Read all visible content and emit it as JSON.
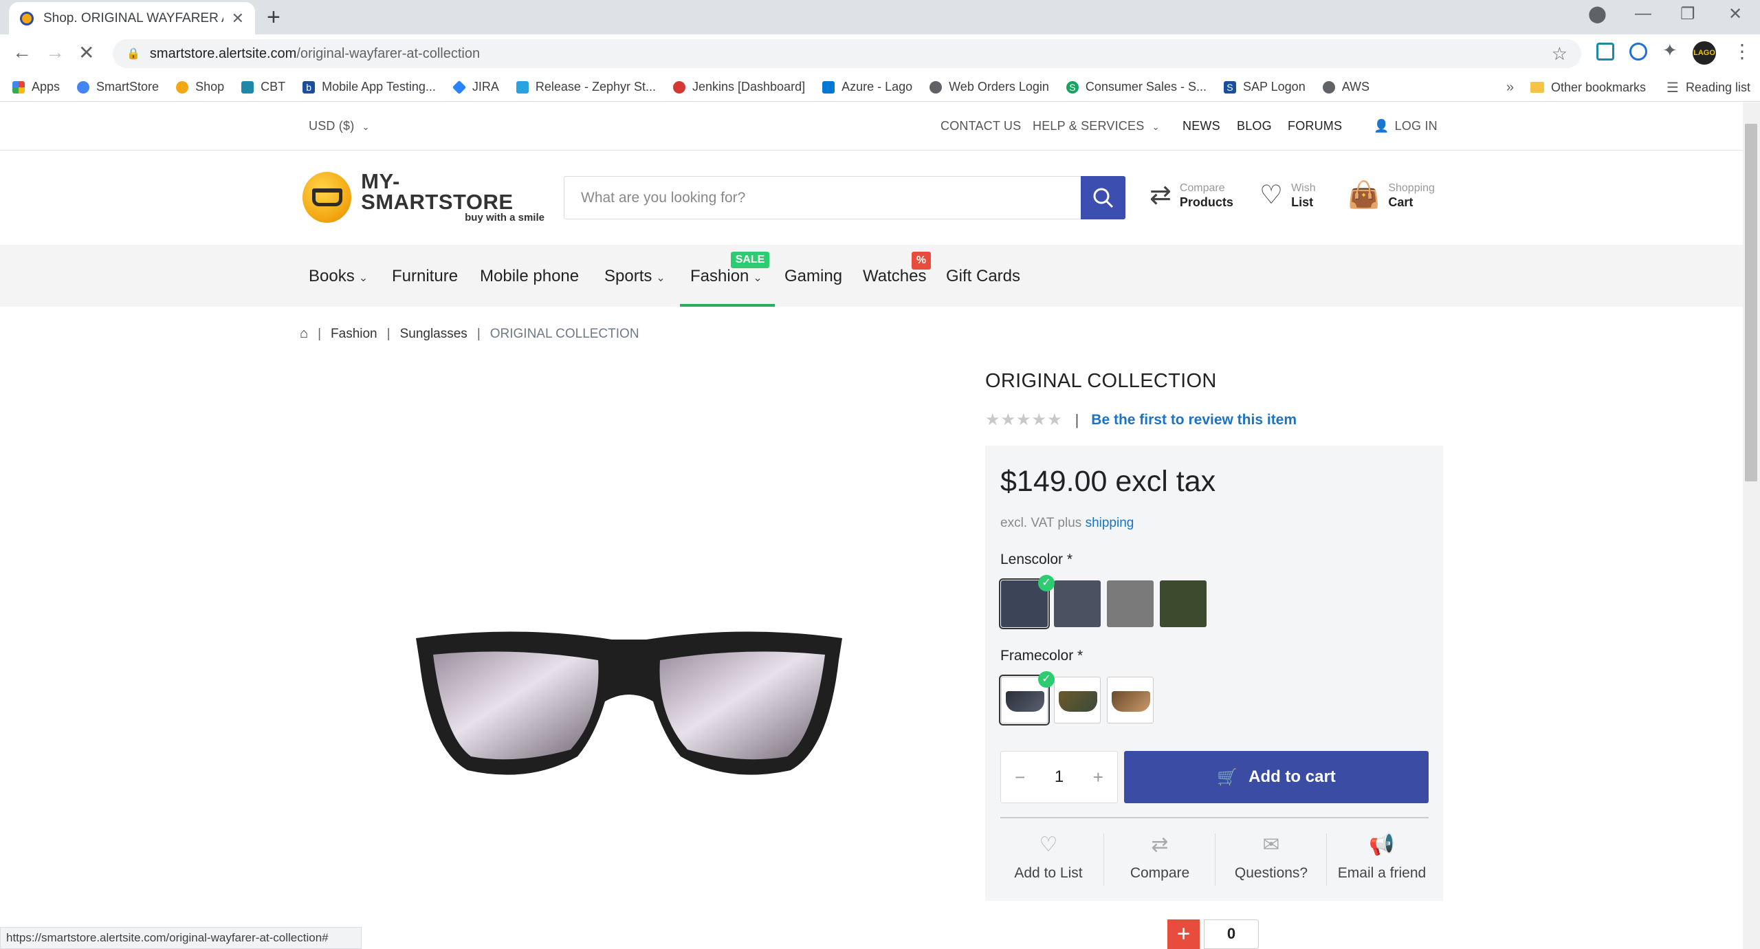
{
  "browser": {
    "tab_title": "Shop. ORIGINAL WAYFARER AT C",
    "url_domain": "smartstore.alertsite.com",
    "url_path": "/original-wayfarer-at-collection",
    "status_url": "https://smartstore.alertsite.com/original-wayfarer-at-collection#",
    "bookmarks": [
      "Apps",
      "SmartStore",
      "Shop",
      "CBT",
      "Mobile App Testing...",
      "JIRA",
      "Release - Zephyr St...",
      "Jenkins [Dashboard]",
      "Azure - Lago",
      "Web Orders Login",
      "Consumer Sales - S...",
      "SAP Logon",
      "AWS"
    ],
    "other_bookmarks": "Other bookmarks",
    "reading_list": "Reading list",
    "profile_label": "LAGO"
  },
  "topbar": {
    "currency": "USD ($)",
    "contact": "CONTACT US",
    "help": "HELP & SERVICES",
    "news": "NEWS",
    "blog": "BLOG",
    "forums": "FORUMS",
    "login": "LOG IN"
  },
  "header": {
    "logo_name": "MY-SMARTSTORE",
    "logo_slogan": "buy with a smile",
    "search_placeholder": "What are you looking for?",
    "compare_top": "Compare",
    "compare_bottom": "Products",
    "wish_top": "Wish",
    "wish_bottom": "List",
    "cart_top": "Shopping",
    "cart_bottom": "Cart"
  },
  "categories": [
    "Books",
    "Furniture",
    "Mobile phone",
    "Sports",
    "Fashion",
    "Gaming",
    "Watches",
    "Gift Cards"
  ],
  "badges": {
    "sale": "SALE",
    "percent": "%"
  },
  "breadcrumb": {
    "l1": "Fashion",
    "l2": "Sunglasses",
    "current": "ORIGINAL COLLECTION"
  },
  "product": {
    "title": "ORIGINAL COLLECTION",
    "rating_stars": 0,
    "review_link": "Be the first to review this item",
    "price": "$149.00 excl tax",
    "vat_text": "excl. VAT plus",
    "shipping_link": "shipping",
    "lens_label": "Lenscolor *",
    "lens_colors": [
      "#3b4557",
      "#4a5262",
      "#7a7a7a",
      "#3c4a2e"
    ],
    "frame_label": "Framecolor *",
    "quantity": "1",
    "add_to_cart": "Add to cart",
    "actions": [
      "Add to List",
      "Compare",
      "Questions?",
      "Email a friend"
    ],
    "share_count": "0"
  }
}
